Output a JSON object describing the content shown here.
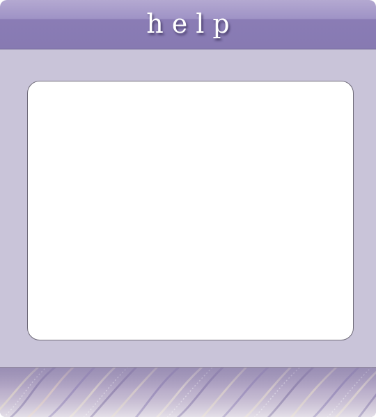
{
  "window": {
    "title": "help"
  },
  "content": {
    "text": ""
  },
  "colors": {
    "titlebar": "#877ab2",
    "body": "#c9c4d9",
    "panel": "#ffffff"
  }
}
